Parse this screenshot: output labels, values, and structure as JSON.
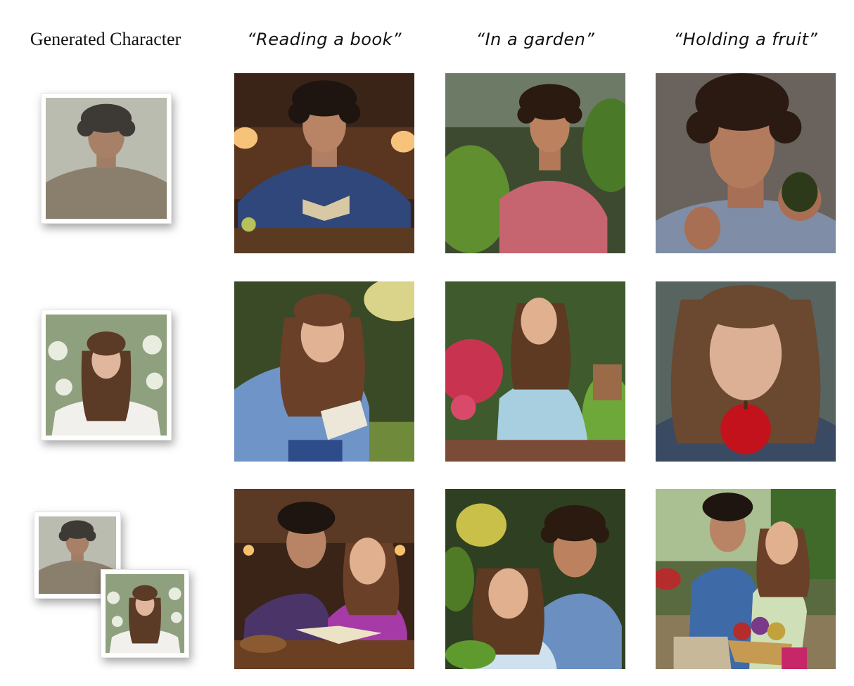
{
  "headers": {
    "column_1": "Generated Character",
    "column_2": "“Reading a book”",
    "column_3": "“In a garden”",
    "column_4": "“Holding a fruit”"
  },
  "rows": [
    {
      "reference": "man-portrait",
      "cells": [
        "man-reading-book",
        "man-in-garden",
        "man-holding-avocado"
      ]
    },
    {
      "reference": "woman-portrait",
      "cells": [
        "woman-reading-book",
        "woman-in-garden",
        "woman-holding-apple"
      ]
    },
    {
      "reference": "man-and-woman-portraits",
      "cells": [
        "couple-reading-book",
        "couple-in-garden",
        "couple-holding-fruit-basket"
      ]
    }
  ]
}
